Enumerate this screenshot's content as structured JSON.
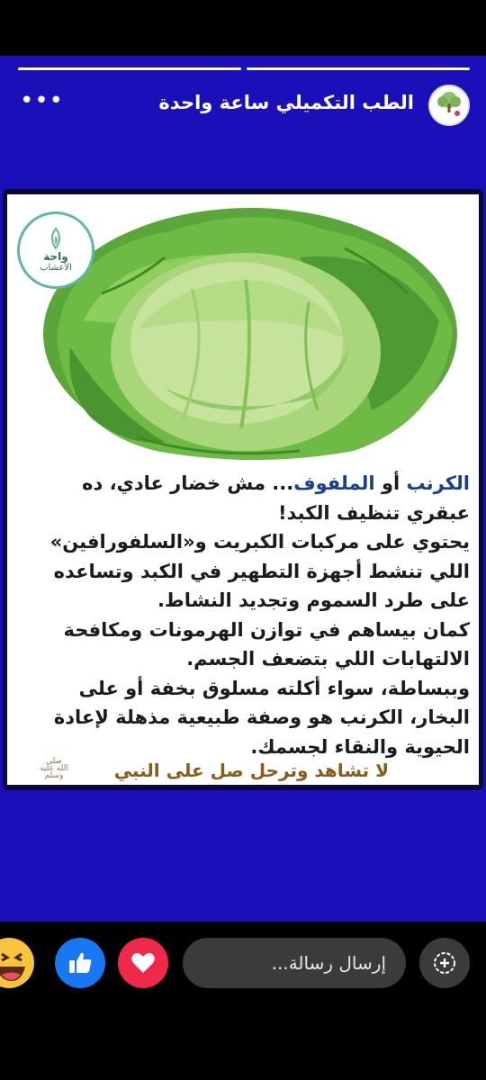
{
  "story": {
    "page_name": "الطب التكميلي ساعة واحدة",
    "more_label": "•••",
    "avatar_text": "الطب التكميلي"
  },
  "post": {
    "logo_line1": "واحة",
    "logo_line2": "الأعشاب",
    "title_highlight1": "الكرنب",
    "title_connector": " أو ",
    "title_highlight2": "الملفوف",
    "title_rest": "... مش خضار عادي، ده عبقري تنظيف الكبد!",
    "paragraph1": "يحتوي على مركبات الكبريت و«السلفورافين» اللي تنشط أجهزة التطهير في الكبد وتساعده على طرد السموم وتجديد النشاط.",
    "paragraph2": "كمان بيساهم في توازن الهرمونات ومكافحة الالتهابات اللي بتضعف الجسم.",
    "paragraph3": "وببساطة، سواء أكلته مسلوق بخفة أو على البخار، الكرنب هو وصفة طبيعية مذهلة لإعادة الحيوية والنقاء لجسمك.",
    "closing": "لا تشاهد وترحل صل على النبي",
    "salawat": "صلى الله عليه وسلم"
  },
  "bottom_bar": {
    "message_placeholder": "إرسال رسالة...",
    "reactions": [
      "haha",
      "like",
      "love"
    ]
  },
  "colors": {
    "story_background": "#1a0fb8",
    "like_blue": "#1877f2",
    "love_red": "#f02849",
    "haha_yellow": "#f7c43b"
  }
}
